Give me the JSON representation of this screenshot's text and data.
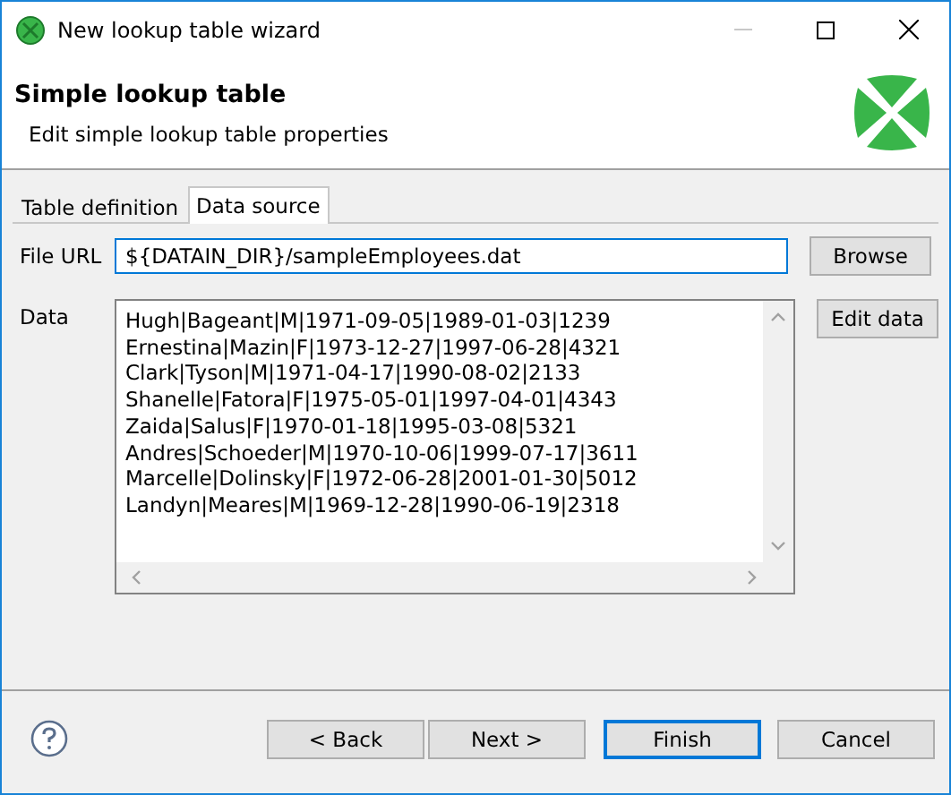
{
  "window": {
    "title": "New lookup table wizard",
    "minimize_enabled": false
  },
  "header": {
    "title": "Simple lookup table",
    "subtitle": "Edit simple lookup table properties"
  },
  "tabs": [
    {
      "label": "Table definition",
      "selected": false
    },
    {
      "label": "Data source",
      "selected": true
    }
  ],
  "file_url": {
    "label": "File URL",
    "value": "${DATAIN_DIR}/sampleEmployees.dat",
    "focused": true,
    "button": "Browse"
  },
  "data": {
    "label": "Data",
    "button": "Edit data",
    "lines": [
      "Hugh|Bageant|M|1971-09-05|1989-01-03|1239",
      "Ernestina|Mazin|F|1973-12-27|1997-06-28|4321",
      "Clark|Tyson|M|1971-04-17|1990-08-02|2133",
      "Shanelle|Fatora|F|1975-05-01|1997-04-01|4343",
      "Zaida|Salus|F|1970-01-18|1995-03-08|5321",
      "Andres|Schoeder|M|1970-10-06|1999-07-17|3611",
      "Marcelle|Dolinsky|F|1972-06-28|2001-01-30|5012",
      "Landyn|Meares|M|1969-12-28|1990-06-19|2318"
    ]
  },
  "buttons": [
    {
      "label": "< Back",
      "default": false
    },
    {
      "label": "Next >",
      "default": false
    },
    {
      "label": "Finish",
      "default": true
    },
    {
      "label": "Cancel",
      "default": false
    }
  ]
}
